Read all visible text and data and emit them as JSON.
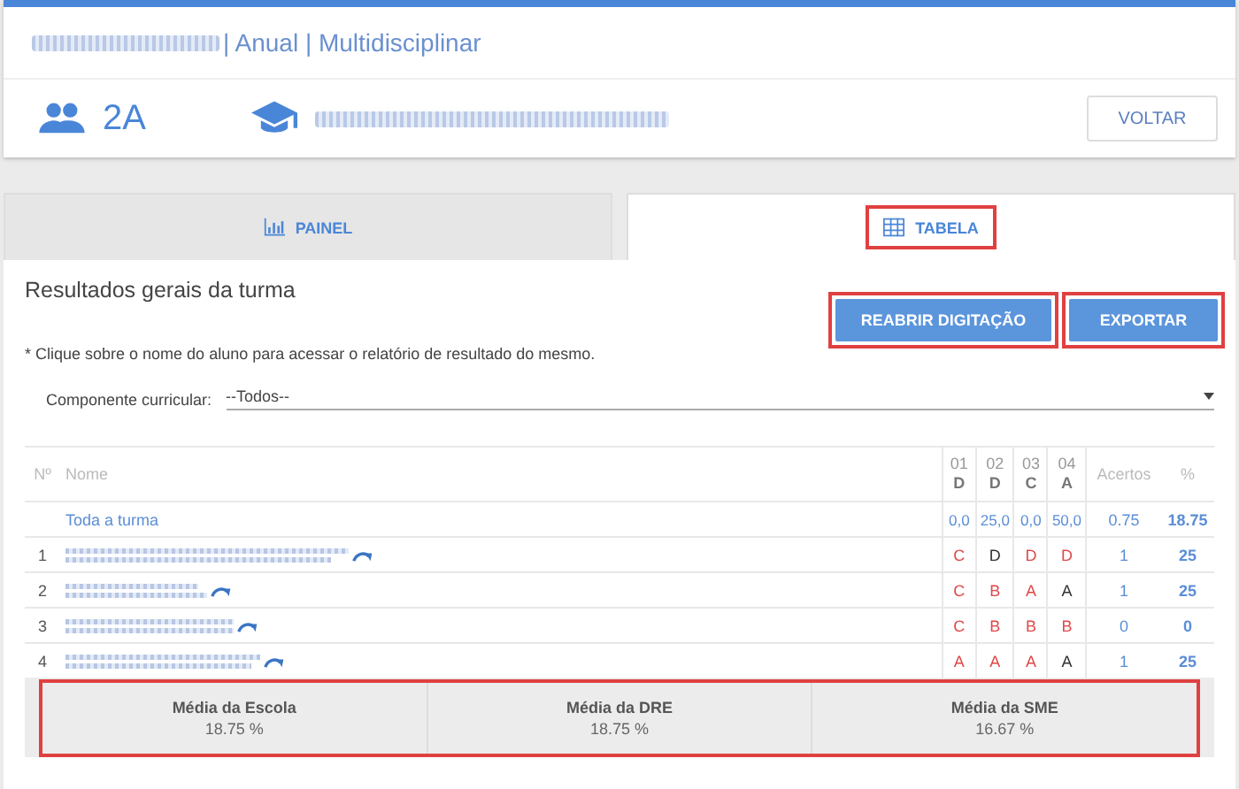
{
  "header": {
    "title": "| Anual | Multidisciplinar",
    "class_name": "2A",
    "back_button": "VOLTAR"
  },
  "tabs": [
    {
      "label": "PAINEL",
      "kind": "chart",
      "selected": false,
      "highlighted": false
    },
    {
      "label": "TABELA",
      "kind": "table",
      "selected": true,
      "highlighted": true
    }
  ],
  "section_title": "Resultados gerais da turma",
  "buttons": [
    {
      "label": "REABRIR DIGITAÇÃO",
      "highlighted": true
    },
    {
      "label": "EXPORTAR",
      "highlighted": true
    }
  ],
  "hint": "* Clique sobre o nome do aluno para acessar o relatório de resultado do mesmo.",
  "filter": {
    "label": "Componente curricular:",
    "value": "--Todos--"
  },
  "table": {
    "columns": {
      "number": "Nº",
      "name": "Nome",
      "items": [
        {
          "number": "01",
          "key": "D"
        },
        {
          "number": "02",
          "key": "D"
        },
        {
          "number": "03",
          "key": "C"
        },
        {
          "number": "04",
          "key": "A"
        }
      ],
      "hits": "Acertos",
      "percent": "%"
    },
    "summary": {
      "name": "Toda a turma",
      "items": [
        "0,0",
        "25,0",
        "0,0",
        "50,0"
      ],
      "hits": "0.75",
      "percent": "18.75"
    },
    "rows": [
      {
        "number": "1",
        "answers": [
          {
            "value": "C",
            "correct": false
          },
          {
            "value": "D",
            "correct": true
          },
          {
            "value": "D",
            "correct": false
          },
          {
            "value": "D",
            "correct": false
          }
        ],
        "hits": "1",
        "percent": "25"
      },
      {
        "number": "2",
        "answers": [
          {
            "value": "C",
            "correct": false
          },
          {
            "value": "B",
            "correct": false
          },
          {
            "value": "A",
            "correct": false
          },
          {
            "value": "A",
            "correct": true
          }
        ],
        "hits": "1",
        "percent": "25"
      },
      {
        "number": "3",
        "answers": [
          {
            "value": "C",
            "correct": false
          },
          {
            "value": "B",
            "correct": false
          },
          {
            "value": "B",
            "correct": false
          },
          {
            "value": "B",
            "correct": false
          }
        ],
        "hits": "0",
        "percent": "0"
      },
      {
        "number": "4",
        "answers": [
          {
            "value": "A",
            "correct": false
          },
          {
            "value": "A",
            "correct": false
          },
          {
            "value": "A",
            "correct": false
          },
          {
            "value": "A",
            "correct": true
          }
        ],
        "hits": "1",
        "percent": "25"
      }
    ]
  },
  "averages": {
    "highlighted": true,
    "items": [
      {
        "label": "Média da Escola",
        "value": "18.75 %"
      },
      {
        "label": "Média da DRE",
        "value": "18.75 %"
      },
      {
        "label": "Média da SME",
        "value": "16.67 %"
      }
    ]
  }
}
